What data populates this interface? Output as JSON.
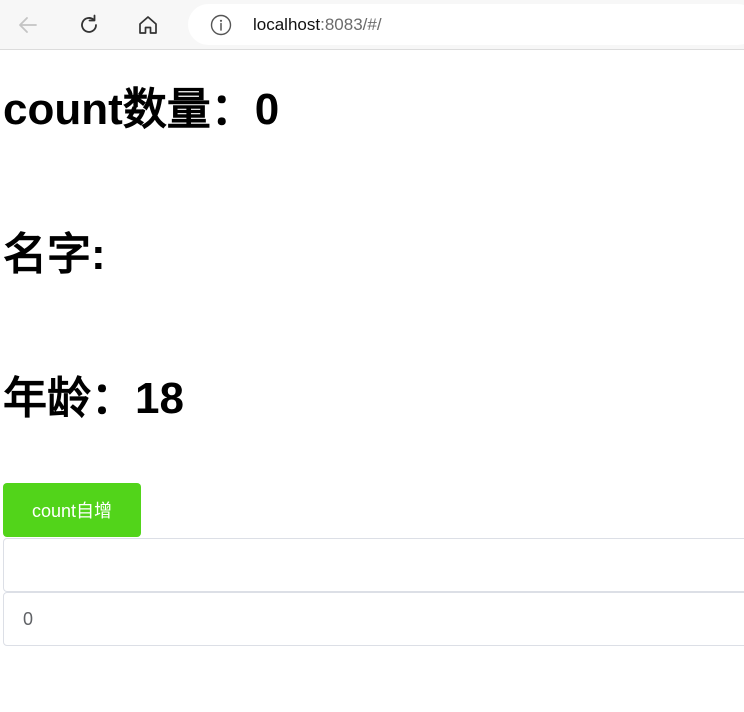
{
  "browser": {
    "url_host": "localhost",
    "url_rest": ":8083/#/",
    "icons": {
      "back": "arrow-left-icon",
      "refresh": "refresh-icon",
      "home": "home-icon",
      "info": "info-icon"
    }
  },
  "page": {
    "count_label": "count数量：",
    "count_value": "0",
    "name_label": "名字:",
    "name_value": "",
    "age_label": "年龄：",
    "age_value": "18",
    "increment_button_label": "count自增",
    "name_input_value": "",
    "count_input_value": "0"
  },
  "colors": {
    "button_bg": "#52d41a",
    "button_text": "#ffffff",
    "input_border": "#dcdfe6"
  }
}
